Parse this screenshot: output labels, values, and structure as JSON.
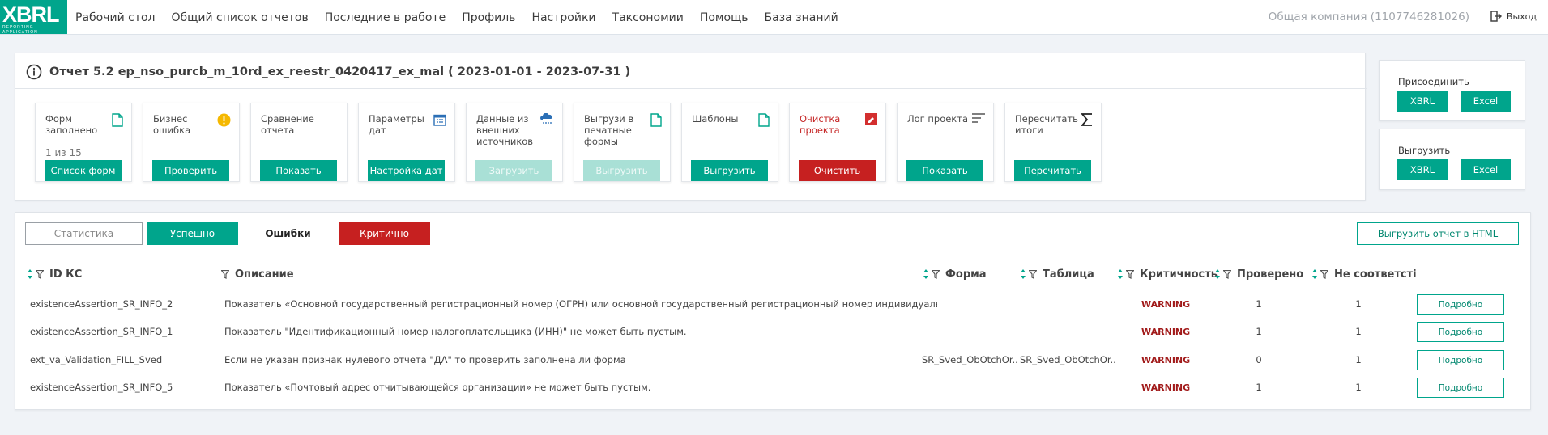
{
  "logo": {
    "text": "XBRL",
    "tagline": "REPORTING APPLICATION"
  },
  "nav": [
    "Рабочий стол",
    "Общий список отчетов",
    "Последние в работе",
    "Профиль",
    "Настройки",
    "Таксономии",
    "Помощь",
    "База знаний"
  ],
  "company": "Общая компания (1107746281026)",
  "logout": "Выход",
  "report": {
    "title": "Отчет 5.2 ep_nso_purcb_m_10rd_ex_reestr_0420417_ex_mal ( 2023-01-01 - 2023-07-31 )"
  },
  "tiles": [
    {
      "label": "Форм заполнено",
      "sub": "1 из 15",
      "button": "Список форм",
      "icon": "document-icon"
    },
    {
      "label": "Бизнес ошибка",
      "button": "Проверить",
      "icon": "warning-icon"
    },
    {
      "label": "Сравнение отчета",
      "button": "Показать",
      "icon": ""
    },
    {
      "label": "Параметры дат",
      "button": "Настройка дат",
      "icon": "calendar-icon"
    },
    {
      "label": "Данные из внешних источников",
      "button": "Загрузить",
      "icon": "cloud-icon"
    },
    {
      "label": "Выгрузи в печатные формы",
      "button": "Выгрузить",
      "icon": "document-icon"
    },
    {
      "label": "Шаблоны",
      "button": "Выгрузить",
      "icon": "document-icon"
    },
    {
      "label": "Очистка проекта",
      "button": "Очистить",
      "icon": "eraser-icon"
    },
    {
      "label": "Лог проекта",
      "button": "Показать",
      "icon": "list-icon"
    },
    {
      "label": "Пересчитать итоги",
      "button": "Персчитать",
      "icon": "sigma-icon"
    }
  ],
  "attach": {
    "title": "Присоединить",
    "xbrl": "XBRL",
    "excel": "Excel"
  },
  "export": {
    "title": "Выгрузить",
    "xbrl": "XBRL",
    "excel": "Excel"
  },
  "tabs": {
    "stat": "Статистика",
    "ok": "Успешно",
    "errors": "Ошибки",
    "critical": "Критично"
  },
  "export_html": "Выгрузить отчет в HTML",
  "columns": {
    "id": "ID КС",
    "desc": "Описание",
    "form": "Форма",
    "table": "Таблица",
    "crit": "Критичность",
    "checked": "Проверено",
    "mismatch": "Не соответсті"
  },
  "rows": [
    {
      "id": "existenceAssertion_SR_INFO_2",
      "desc": "Показатель «Основной государственный регистрационный номер (ОГРН) или основной государственный регистрационный номер индивидуальног...",
      "form": "",
      "table": "",
      "crit": "WARNING",
      "checked": "1",
      "mismatch": "1",
      "btn": "Подробно"
    },
    {
      "id": "existenceAssertion_SR_INFO_1",
      "desc": "Показатель \"Идентификационный номер налогоплательщика (ИНН)\" не может быть пустым.",
      "form": "",
      "table": "",
      "crit": "WARNING",
      "checked": "1",
      "mismatch": "1",
      "btn": "Подробно"
    },
    {
      "id": "ext_va_Validation_FILL_Sved",
      "desc": "Если не указан признак нулевого отчета \"ДА\" то проверить заполнена ли форма",
      "form": "SR_Sved_ObOtchOr...",
      "table": "SR_Sved_ObOtchOr...",
      "crit": "WARNING",
      "checked": "0",
      "mismatch": "1",
      "btn": "Подробно"
    },
    {
      "id": "existenceAssertion_SR_INFO_5",
      "desc": "Показатель «Почтовый адрес отчитывающейся организации» не может быть пустым.",
      "form": "",
      "table": "",
      "crit": "WARNING",
      "checked": "1",
      "mismatch": "1",
      "btn": "Подробно"
    }
  ]
}
